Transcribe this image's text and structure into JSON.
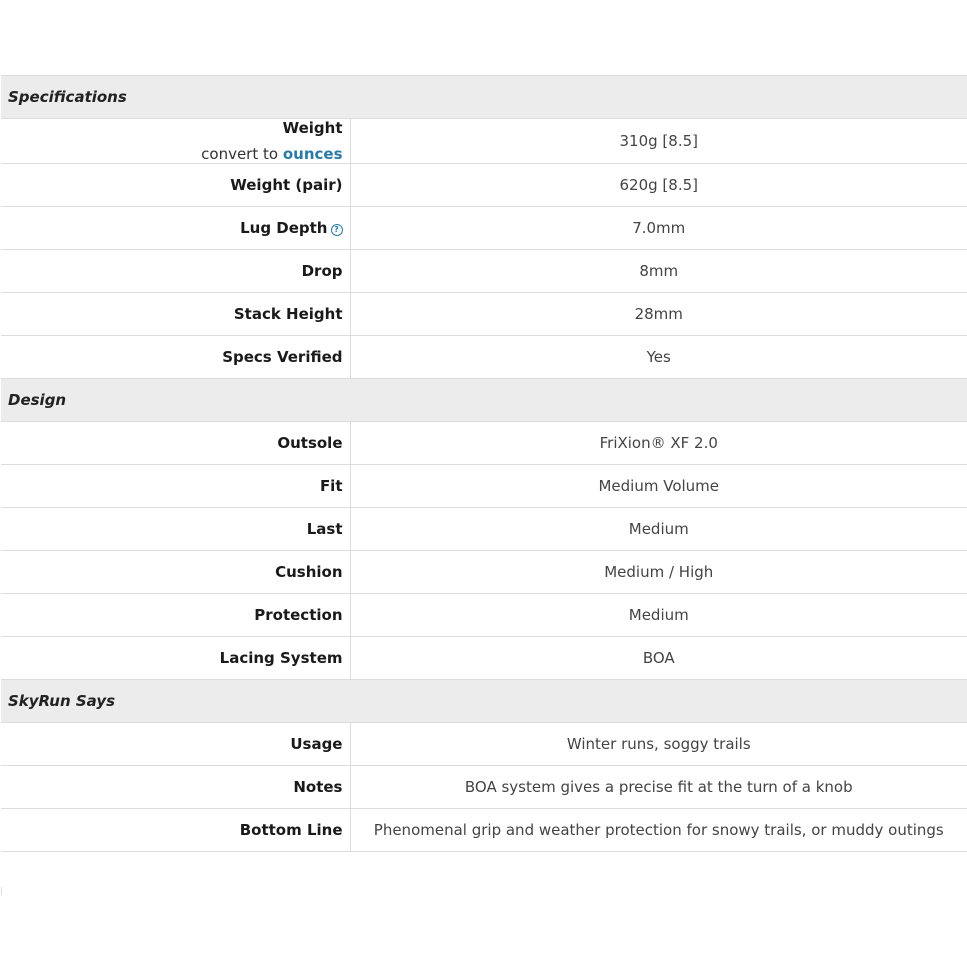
{
  "sections": {
    "specifications": {
      "title": "Specifications",
      "rows": [
        {
          "label": "Weight",
          "value": "310g [8.5]",
          "sub_prefix": "convert to",
          "sub_link": "ounces"
        },
        {
          "label": "Weight (pair)",
          "value": "620g [8.5]"
        },
        {
          "label": "Lug Depth",
          "value": "7.0mm",
          "help_icon": "question-circle-icon"
        },
        {
          "label": "Drop",
          "value": "8mm"
        },
        {
          "label": "Stack Height",
          "value": "28mm"
        },
        {
          "label": "Specs Verified",
          "value": "Yes"
        }
      ]
    },
    "design": {
      "title": "Design",
      "rows": [
        {
          "label": "Outsole",
          "value": "FriXion® XF 2.0"
        },
        {
          "label": "Fit",
          "value": "Medium Volume"
        },
        {
          "label": "Last",
          "value": "Medium"
        },
        {
          "label": "Cushion",
          "value": "Medium / High"
        },
        {
          "label": "Protection",
          "value": "Medium"
        },
        {
          "label": "Lacing System",
          "value": "BOA"
        }
      ]
    },
    "skyrun": {
      "title": "SkyRun Says",
      "rows": [
        {
          "label": "Usage",
          "value": "Winter runs, soggy trails"
        },
        {
          "label": "Notes",
          "value": "BOA system gives a precise fit at the turn of a knob"
        },
        {
          "label": "Bottom Line",
          "value": "Phenomenal grip and weather protection for snowy trails, or muddy outings"
        }
      ]
    }
  },
  "colors": {
    "link": "#2a7aa8",
    "section_bg": "#ececec",
    "border": "#dddddd"
  }
}
